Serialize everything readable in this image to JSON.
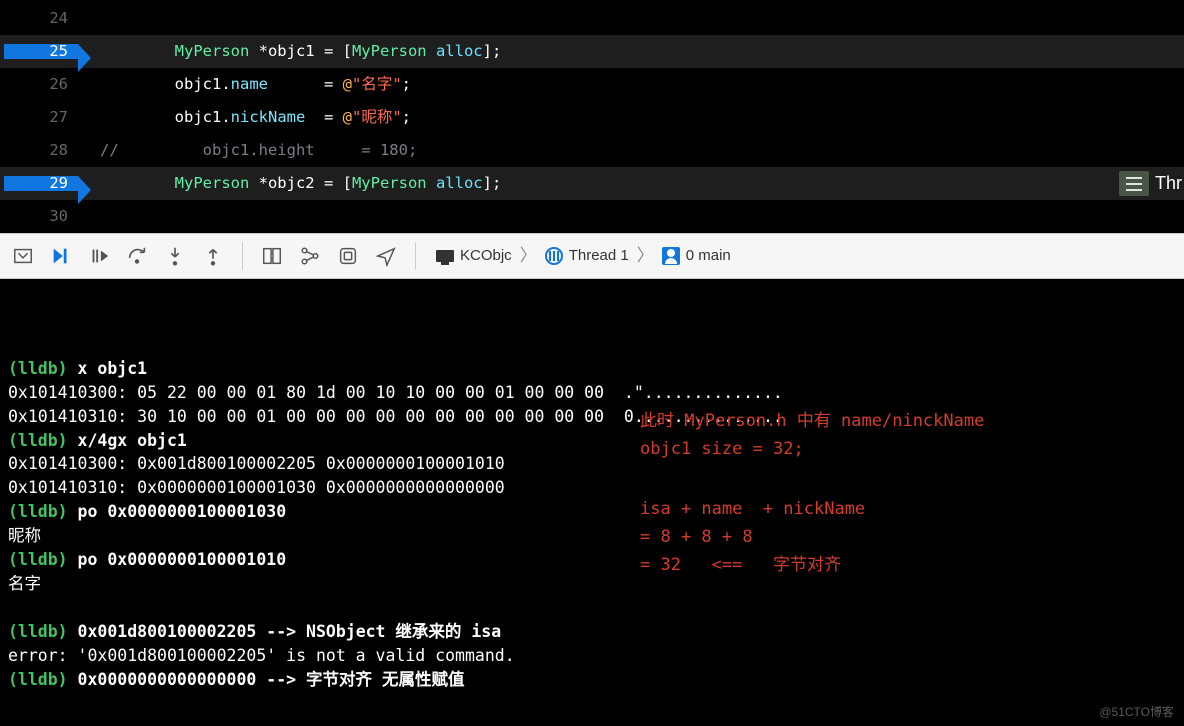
{
  "editor": {
    "lines": [
      {
        "num": "24",
        "active": false,
        "tokens": []
      },
      {
        "num": "25",
        "active": true,
        "tokens": [
          {
            "t": "        ",
            "c": "plain"
          },
          {
            "t": "MyPerson",
            "c": "type"
          },
          {
            "t": " *objc1 = [",
            "c": "plain"
          },
          {
            "t": "MyPerson",
            "c": "type"
          },
          {
            "t": " ",
            "c": "plain"
          },
          {
            "t": "alloc",
            "c": "sel"
          },
          {
            "t": "];",
            "c": "plain"
          }
        ]
      },
      {
        "num": "26",
        "active": false,
        "tokens": [
          {
            "t": "        objc1.",
            "c": "plain"
          },
          {
            "t": "name",
            "c": "prop"
          },
          {
            "t": "      = ",
            "c": "plain"
          },
          {
            "t": "@",
            "c": "lit"
          },
          {
            "t": "\"名字\"",
            "c": "str"
          },
          {
            "t": ";",
            "c": "plain"
          }
        ]
      },
      {
        "num": "27",
        "active": false,
        "tokens": [
          {
            "t": "        objc1.",
            "c": "plain"
          },
          {
            "t": "nickName",
            "c": "prop"
          },
          {
            "t": "  = ",
            "c": "plain"
          },
          {
            "t": "@",
            "c": "lit"
          },
          {
            "t": "\"昵称\"",
            "c": "str"
          },
          {
            "t": ";",
            "c": "plain"
          }
        ]
      },
      {
        "num": "28",
        "active": false,
        "tokens": [
          {
            "t": "//         objc1.height     = 180;",
            "c": "comment"
          }
        ]
      },
      {
        "num": "29",
        "active": true,
        "tokens": [
          {
            "t": "        ",
            "c": "plain"
          },
          {
            "t": "MyPerson",
            "c": "type"
          },
          {
            "t": " *objc2 = [",
            "c": "plain"
          },
          {
            "t": "MyPerson",
            "c": "type"
          },
          {
            "t": " ",
            "c": "plain"
          },
          {
            "t": "alloc",
            "c": "sel"
          },
          {
            "t": "];",
            "c": "plain"
          }
        ],
        "rightBadge": true
      },
      {
        "num": "30",
        "active": false,
        "tokens": []
      }
    ],
    "right_badge_text": "Thr"
  },
  "breadcrumb": {
    "target": "KCObjc",
    "thread": "Thread 1",
    "frame": "0 main"
  },
  "console": {
    "lines": [
      {
        "kind": "cmd",
        "prompt": "(lldb) ",
        "cmd": "x objc1"
      },
      {
        "kind": "out",
        "text": "0x101410300: 05 22 00 00 01 80 1d 00 10 10 00 00 01 00 00 00  .\"..............\n0x101410310: 30 10 00 00 01 00 00 00 00 00 00 00 00 00 00 00  0..............."
      },
      {
        "kind": "cmd",
        "prompt": "(lldb) ",
        "cmd": "x/4gx objc1"
      },
      {
        "kind": "out",
        "text": "0x101410300: 0x001d800100002205 0x0000000100001010\n0x101410310: 0x0000000100001030 0x0000000000000000"
      },
      {
        "kind": "cmd",
        "prompt": "(lldb) ",
        "cmd": "po 0x0000000100001030"
      },
      {
        "kind": "out",
        "text": "昵称\n"
      },
      {
        "kind": "cmd",
        "prompt": "(lldb) ",
        "cmd": "po 0x0000000100001010"
      },
      {
        "kind": "out",
        "text": "名字\n\n"
      },
      {
        "kind": "cmd",
        "prompt": "(lldb) ",
        "cmd": "0x001d800100002205 --> NSObject 继承来的 isa"
      },
      {
        "kind": "out",
        "text": "error: '0x001d800100002205' is not a valid command."
      },
      {
        "kind": "cmd",
        "prompt": "(lldb) ",
        "cmd": "0x0000000000000000 --> 字节对齐 无属性赋值"
      }
    ]
  },
  "annotations": {
    "top": "此时 MyPerson.h 中有 name/ninckName\nobjc1 size = 32;",
    "bottom": "isa + name  + nickName\n= 8 + 8 + 8\n= 32   <==   字节对齐"
  },
  "watermark": "@51CTO博客"
}
